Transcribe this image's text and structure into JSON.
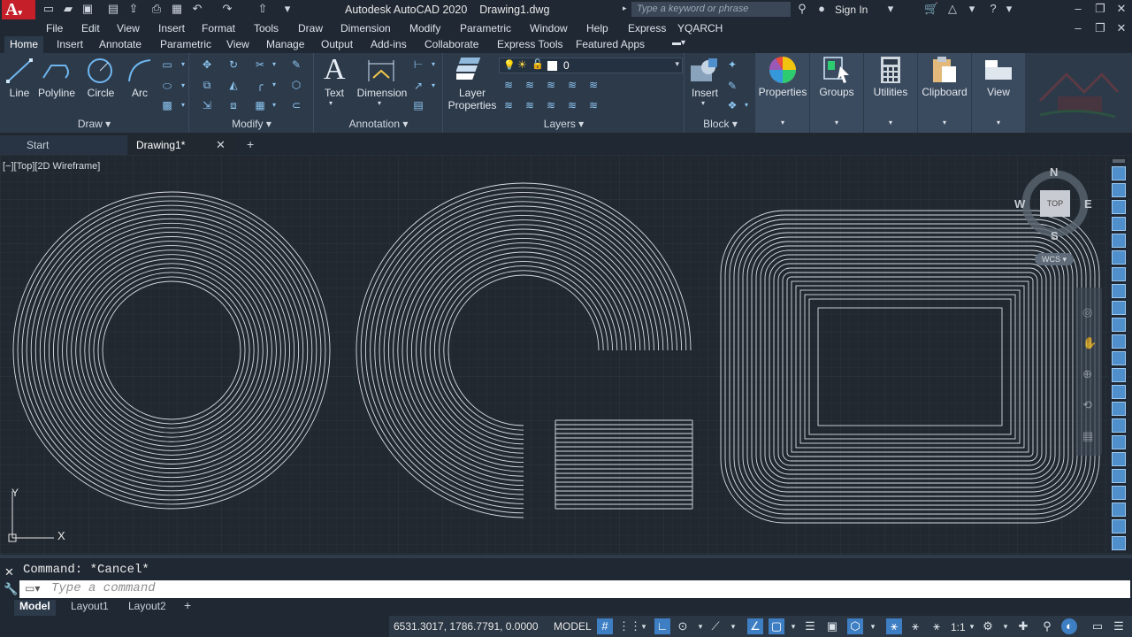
{
  "title_bar": {
    "app_title": "Autodesk AutoCAD 2020",
    "file_name": "Drawing1.dwg",
    "search_placeholder": "Type a keyword or phrase",
    "sign_in": "Sign In"
  },
  "menu": [
    "File",
    "Edit",
    "View",
    "Insert",
    "Format",
    "Tools",
    "Draw",
    "Dimension",
    "Modify",
    "Parametric",
    "Window",
    "Help",
    "Express",
    "YQARCH"
  ],
  "ribbon_tabs": [
    "Home",
    "Insert",
    "Annotate",
    "Parametric",
    "View",
    "Manage",
    "Output",
    "Add-ins",
    "Collaborate",
    "Express Tools",
    "Featured Apps"
  ],
  "ribbon": {
    "draw": {
      "line": "Line",
      "polyline": "Polyline",
      "circle": "Circle",
      "arc": "Arc",
      "panel": "Draw"
    },
    "modify": {
      "panel": "Modify"
    },
    "annotation": {
      "text": "Text",
      "dimension": "Dimension",
      "panel": "Annotation"
    },
    "layers": {
      "layer_properties_1": "Layer",
      "layer_properties_2": "Properties",
      "current_layer": "0",
      "panel": "Layers"
    },
    "block": {
      "insert": "Insert",
      "panel": "Block"
    },
    "properties": "Properties",
    "groups": "Groups",
    "utilities": "Utilities",
    "clipboard": "Clipboard",
    "view": "View"
  },
  "file_tabs": {
    "start": "Start",
    "drawing": "Drawing1*"
  },
  "viewport": {
    "label": "[−][Top][2D Wireframe]",
    "viewcube": {
      "n": "N",
      "s": "S",
      "e": "E",
      "w": "W",
      "top": "TOP",
      "wcs": "WCS"
    },
    "ucs": {
      "x": "X",
      "y": "Y"
    }
  },
  "command": {
    "history": "Command: *Cancel*",
    "placeholder": "Type a command"
  },
  "layout_tabs": [
    "Model",
    "Layout1",
    "Layout2"
  ],
  "status": {
    "coordinates": "6531.3017, 1786.7791, 0.0000",
    "mode": "MODEL",
    "scale": "1:1"
  },
  "colors": {
    "accent": "#3e7fc4",
    "brand": "#c51f2a",
    "ribbon_bg": "#2c3a4a",
    "canvas_bg": "#212830"
  }
}
